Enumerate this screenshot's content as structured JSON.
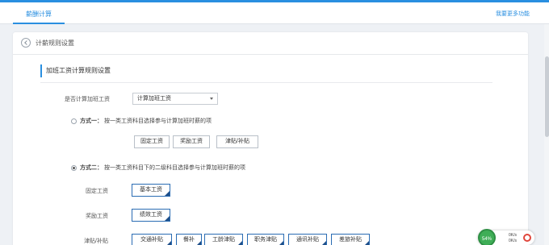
{
  "nav": {
    "tab_label": "薪酬计算",
    "more_link": "我要更多功能"
  },
  "header": {
    "title": "计薪规则设置"
  },
  "section": {
    "title": "加班工资计算规则设置"
  },
  "calc_overtime": {
    "label": "是否计算加班工资",
    "value": "计算加班工资"
  },
  "method1": {
    "title": "方式一：",
    "desc": "按一类工资科目选择参与计算加班时薪的项",
    "checked": false,
    "tags": [
      "固定工资",
      "奖励工资",
      "津贴/补贴"
    ]
  },
  "method2": {
    "title": "方式二：",
    "desc": "按一类工资科目下的二级科目选择参与计算加班时薪的项",
    "checked": true,
    "groups": [
      {
        "label": "固定工资",
        "items": [
          "基本工资"
        ]
      },
      {
        "label": "奖励工资",
        "items": [
          "绩效工资"
        ]
      },
      {
        "label": "津贴/补贴",
        "items": [
          "交通补贴",
          "餐补",
          "工龄津贴",
          "职务津贴",
          "通讯补贴",
          "差旅补贴"
        ]
      }
    ]
  },
  "widget": {
    "percent": "54%",
    "up": "0K/s",
    "down": "0K/s"
  }
}
